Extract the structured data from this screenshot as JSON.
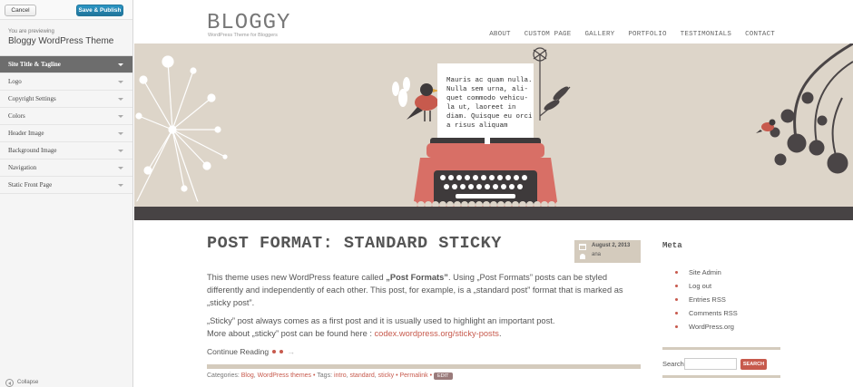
{
  "customizer": {
    "cancel_label": "Cancel",
    "save_label": "Save & Publish",
    "previewing_note": "You are previewing",
    "theme_name": "Bloggy WordPress Theme",
    "sections": [
      {
        "label": "Site Title & Tagline",
        "active": true
      },
      {
        "label": "Logo"
      },
      {
        "label": "Copyright Settings"
      },
      {
        "label": "Colors"
      },
      {
        "label": "Header Image"
      },
      {
        "label": "Background Image"
      },
      {
        "label": "Navigation"
      },
      {
        "label": "Static Front Page"
      }
    ],
    "collapse_label": "Collapse"
  },
  "site": {
    "logo": "BLOGGY",
    "tagline": "WordPress Theme for Bloggers",
    "nav": [
      "ABOUT",
      "CUSTOM PAGE",
      "GALLERY",
      "PORTFOLIO",
      "TESTIMONIALS",
      "CONTACT"
    ],
    "banner_paper_lines": [
      "Mauris ac quam nulla.",
      "Nulla sem urna, ali-",
      "quet commodo vehicu-",
      "la ut, laoreet in",
      "diam. Quisque eu orci",
      "a risus aliquam"
    ]
  },
  "post": {
    "title": "POST FORMAT: STANDARD STICKY",
    "date": "August 2, 2013",
    "author": "ana",
    "p1_a": "This theme uses new WordPress feature called ",
    "p1_b": "„Post Formats”",
    "p1_c": ". Using „Post Formats” posts can be styled differently and independently of each other. This post, for example, is a „standard post” format that is marked as „sticky post”.",
    "p2_a": "„Sticky” post always comes as a first post and it is usually used to highlight an important post.",
    "p2_b": "More about „sticky” post can be found here : ",
    "p2_link": "codex.wordpress.org/sticky-posts",
    "p2_c": ".",
    "continue_label": "Continue Reading",
    "meta": {
      "categories_label": "Categories: ",
      "categories": [
        "Blog",
        "WordPress themes"
      ],
      "tags_label": "Tags: ",
      "tags": [
        "intro",
        "standard",
        "sticky"
      ],
      "permalink": "Permalink",
      "edit": "EDIT"
    }
  },
  "widget": {
    "title": "Meta",
    "items": [
      "Site Admin",
      "Log out",
      "Entries RSS",
      "Comments RSS",
      "WordPress.org"
    ],
    "search_label": "Search",
    "search_button": "SEARCH"
  },
  "colors": {
    "accent": "#c75a4d",
    "banner_bg": "#ddd5c9",
    "banner_dark": "#474344",
    "customizer_active": "#6d6d6d",
    "publish_blue": "#21759b"
  }
}
